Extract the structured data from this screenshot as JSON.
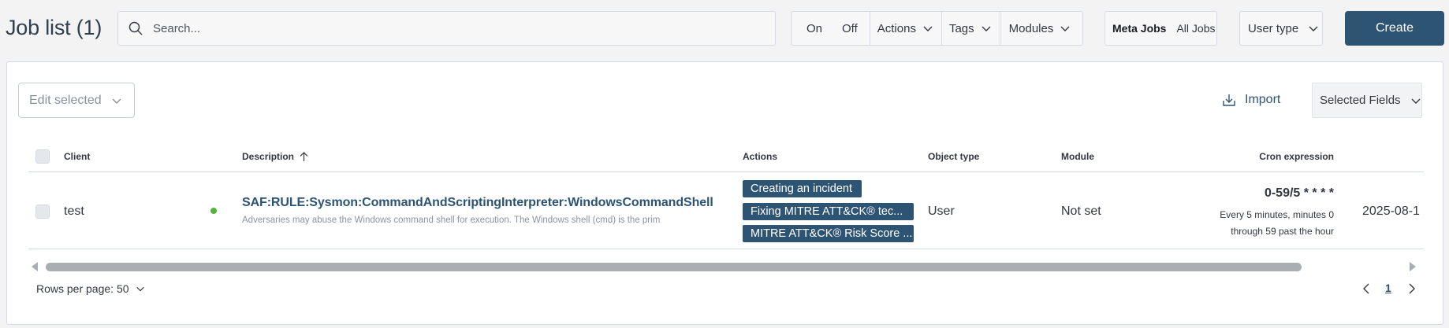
{
  "header": {
    "title": "Job list (1)",
    "search_placeholder": "Search...",
    "filters": {
      "on": "On",
      "off": "Off",
      "actions": "Actions",
      "tags": "Tags",
      "modules": "Modules"
    },
    "jobs_switch": {
      "meta": "Meta Jobs",
      "all": "All Jobs"
    },
    "user_type": "User type",
    "create": "Create"
  },
  "toolbar": {
    "edit_selected": "Edit selected",
    "import": "Import",
    "selected_fields": "Selected Fields"
  },
  "table": {
    "columns": [
      "Client",
      "Description",
      "Actions",
      "Object type",
      "Module",
      "Cron expression"
    ],
    "rows": [
      {
        "client": "test",
        "status": "active",
        "status_color": "#54b33e",
        "title": "SAF:RULE:Sysmon:CommandAndScriptingInterpreter:WindowsCommandShell",
        "description": "Adversaries may abuse the Windows command shell for execution. The Windows shell (cmd) is the prim",
        "actions": [
          "Creating an incident",
          "Fixing MITRE ATT&CK® tec...",
          "MITRE ATT&CK® Risk Score ..."
        ],
        "object_type": "User",
        "module": "Not set",
        "cron": "0-59/5 * * * *",
        "cron_desc_1": "Every 5 minutes, minutes 0",
        "cron_desc_2": "through 59 past the hour",
        "date": "2025-08-1"
      }
    ]
  },
  "pagination": {
    "rows_per_page": "Rows per page: 50",
    "current_page": "1"
  },
  "colors": {
    "accent": "#2d5473",
    "status_active": "#54b33e"
  }
}
